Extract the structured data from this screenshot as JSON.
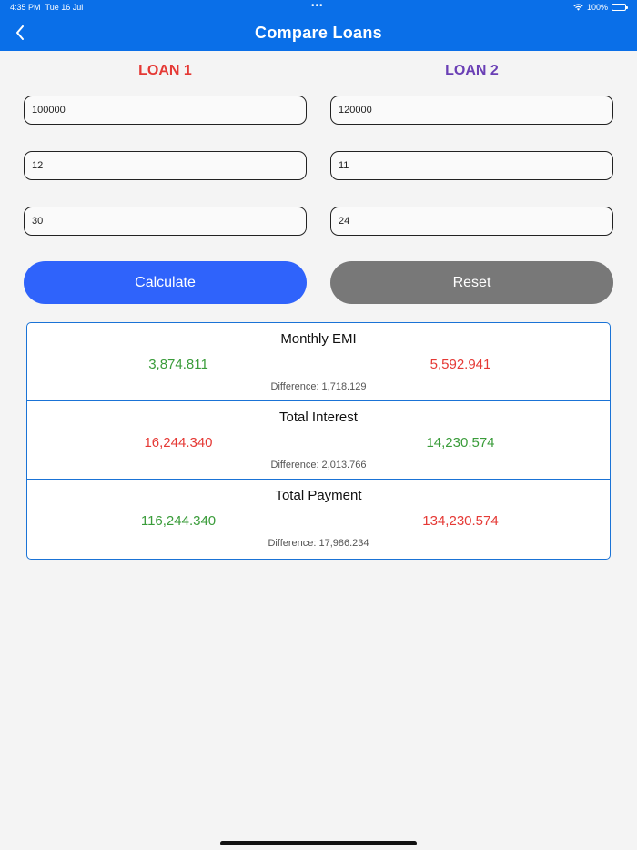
{
  "status_bar": {
    "time": "4:35 PM",
    "date": "Tue 16 Jul",
    "dots": "•••",
    "battery": "100%",
    "battery_level": 1.0
  },
  "header": {
    "title": "Compare Loans"
  },
  "loan1": {
    "label": "LOAN 1",
    "amount": "100000",
    "rate": "12",
    "tenure": "30"
  },
  "loan2": {
    "label": "LOAN 2",
    "amount": "120000",
    "rate": "11",
    "tenure": "24"
  },
  "buttons": {
    "calculate": "Calculate",
    "reset": "Reset"
  },
  "results": {
    "diff_label": "Difference:",
    "monthly_emi": {
      "title": "Monthly EMI",
      "loan1": "3,874.811",
      "loan2": "5,592.941",
      "difference": "1,718.129"
    },
    "total_interest": {
      "title": "Total Interest",
      "loan1": "16,244.340",
      "loan2": "14,230.574",
      "difference": "2,013.766"
    },
    "total_payment": {
      "title": "Total Payment",
      "loan1": "116,244.340",
      "loan2": "134,230.574",
      "difference": "17,986.234"
    }
  },
  "colors": {
    "header": "#0a6fe8",
    "loan1": "#e53935",
    "loan2": "#6a3fb5",
    "calculate": "#2f63fb",
    "reset": "#787878",
    "better": "#3a9c3a",
    "worse": "#e53935"
  }
}
